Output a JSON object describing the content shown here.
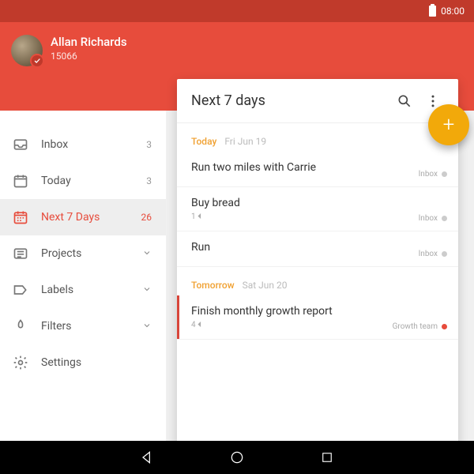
{
  "status": {
    "time": "08:00"
  },
  "user": {
    "name": "Allan Richards",
    "sub": "15066"
  },
  "sidebar": {
    "items": [
      {
        "label": "Inbox",
        "meta": "3"
      },
      {
        "label": "Today",
        "meta": "3"
      },
      {
        "label": "Next 7 Days",
        "meta": "26"
      },
      {
        "label": "Projects",
        "meta": ""
      },
      {
        "label": "Labels",
        "meta": ""
      },
      {
        "label": "Filters",
        "meta": ""
      },
      {
        "label": "Settings",
        "meta": ""
      }
    ]
  },
  "panel": {
    "title": "Next 7 days"
  },
  "sections": [
    {
      "day": "Today",
      "date": "Fri Jun 19",
      "tasks": [
        {
          "title": "Run two miles with Carrie",
          "sub": "",
          "project": "Inbox",
          "dot": "grey",
          "priority": false
        },
        {
          "title": "Buy bread",
          "sub": "1 ⏴",
          "project": "Inbox",
          "dot": "grey",
          "priority": false
        },
        {
          "title": "Run",
          "sub": "",
          "project": "Inbox",
          "dot": "grey",
          "priority": false
        }
      ]
    },
    {
      "day": "Tomorrow",
      "date": "Sat Jun 20",
      "tasks": [
        {
          "title": "Finish monthly growth report",
          "sub": "4 ⏴",
          "project": "Growth team",
          "dot": "red",
          "priority": true
        }
      ]
    }
  ]
}
